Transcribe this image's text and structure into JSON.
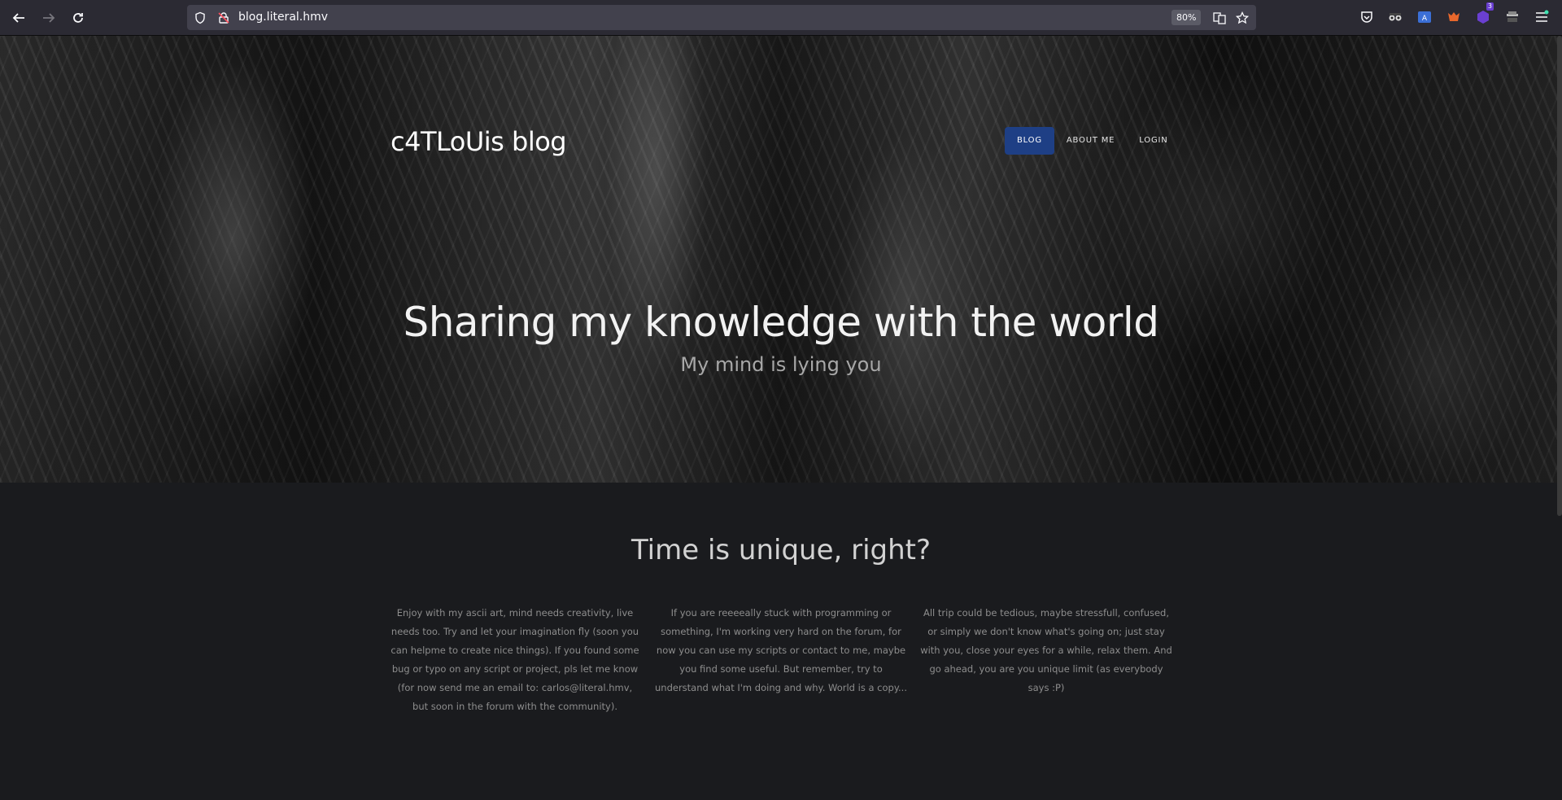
{
  "browser": {
    "url": "blog.literal.hmv",
    "zoom": "80%",
    "extension_badge": "3"
  },
  "site": {
    "brand": "c4TLoUis blog",
    "nav": [
      {
        "label": "BLOG",
        "active": true
      },
      {
        "label": "ABOUT ME",
        "active": false
      },
      {
        "label": "LOGIN",
        "active": false
      }
    ],
    "hero_title": "Sharing my knowledge with the world",
    "hero_subtitle": "My mind is lying you"
  },
  "content": {
    "title": "Time is unique, right?",
    "columns": [
      "Enjoy with my ascii art, mind needs creativity, live needs too. Try and let your imagination fly (soon you can helpme to create nice things). If you found some bug or typo on any script or project, pls let me know (for now send me an email to: carlos@literal.hmv, but soon in the forum with the community).",
      "If you are reeeeally stuck with programming or something, I'm working very hard on the forum, for now you can use my scripts or contact to me, maybe you find some useful. But remember, try to understand what I'm doing and why. World is a copy...",
      "All trip could be tedious, maybe stressfull, confused, or simply we don't know what's going on; just stay with you, close your eyes for a while, relax them. And go ahead, you are you unique limit (as everybody says :P)"
    ]
  },
  "colors": {
    "accent": "#1e3f85",
    "page_bg": "#1a1b1e",
    "toolbar_bg": "#2b2a33"
  }
}
